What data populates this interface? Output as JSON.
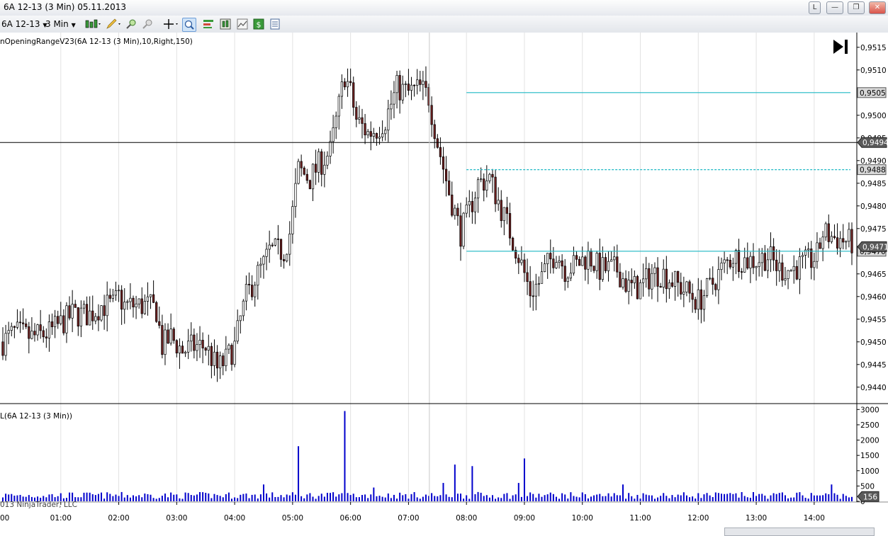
{
  "window": {
    "title": "6A 12-13 (3 Min)  05.11.2013",
    "buttons": [
      "L",
      "—",
      "❐",
      "✕"
    ]
  },
  "toolbar": {
    "instrument": "6A 12-13",
    "interval": "3 Min"
  },
  "panels": {
    "price_label": "nOpeningRangeV23(6A 12-13 (3 Min),10,Right,150)",
    "volume_label": "L(6A 12-13 (3 Min))",
    "copyright": "013 NinjaTrader, LLC",
    "left_tick": "00"
  },
  "colors": {
    "up_candle": "#ffffff",
    "down_candle": "#6e1f1f",
    "candle_outline": "#000000",
    "range_line": "#1fb8c4",
    "volume_bar": "#0000cc",
    "crosshair": "#000000"
  },
  "chart_data": [
    {
      "type": "candlestick",
      "instrument": "6A 12-13",
      "interval": "3 Min",
      "ylim": [
        0.9437,
        0.9517
      ],
      "y_ticks": [
        "0,9515",
        "0,9510",
        "0,9505",
        "0,9500",
        "0,9495",
        "0,9490",
        "0,9485",
        "0,9480",
        "0,9475",
        "0,9470",
        "0,9465",
        "0,9460",
        "0,9455",
        "0,9450",
        "0,9445",
        "0,9440"
      ],
      "x_ticks": [
        "01:00",
        "02:00",
        "03:00",
        "04:00",
        "05:00",
        "06:00",
        "07:00",
        "08:00",
        "09:00",
        "10:00",
        "11:00",
        "12:00",
        "13:00",
        "14:00"
      ],
      "x_ticks_time": [
        1,
        2,
        3,
        4,
        5,
        6,
        7,
        8,
        9,
        10,
        11,
        12,
        13,
        14
      ],
      "xlim": [
        0,
        14.65
      ],
      "price_path": [
        [
          0.0,
          0.945
        ],
        [
          0.2,
          0.9452
        ],
        [
          0.5,
          0.9451
        ],
        [
          0.8,
          0.9452
        ],
        [
          1.0,
          0.9454
        ],
        [
          1.2,
          0.9456
        ],
        [
          1.5,
          0.9456
        ],
        [
          1.7,
          0.9458
        ],
        [
          1.9,
          0.9458
        ],
        [
          2.0,
          0.946
        ],
        [
          2.1,
          0.9458
        ],
        [
          2.3,
          0.9458
        ],
        [
          2.5,
          0.9458
        ],
        [
          2.65,
          0.9457
        ],
        [
          2.75,
          0.9449
        ],
        [
          2.9,
          0.9451
        ],
        [
          3.1,
          0.9448
        ],
        [
          3.3,
          0.9449
        ],
        [
          3.5,
          0.9449
        ],
        [
          3.7,
          0.9444
        ],
        [
          3.85,
          0.9446
        ],
        [
          4.0,
          0.9449
        ],
        [
          4.1,
          0.9455
        ],
        [
          4.2,
          0.946
        ],
        [
          4.35,
          0.9464
        ],
        [
          4.5,
          0.9467
        ],
        [
          4.6,
          0.947
        ],
        [
          4.85,
          0.947
        ],
        [
          4.95,
          0.9474
        ],
        [
          5.1,
          0.9488
        ],
        [
          5.3,
          0.9486
        ],
        [
          5.45,
          0.9489
        ],
        [
          5.65,
          0.9492
        ],
        [
          5.8,
          0.9502
        ],
        [
          5.9,
          0.9509
        ],
        [
          6.0,
          0.9505
        ],
        [
          6.1,
          0.9499
        ],
        [
          6.3,
          0.9496
        ],
        [
          6.45,
          0.9497
        ],
        [
          6.6,
          0.9499
        ],
        [
          6.8,
          0.9506
        ],
        [
          7.0,
          0.9505
        ],
        [
          7.2,
          0.9506
        ],
        [
          7.35,
          0.9504
        ],
        [
          7.5,
          0.9494
        ],
        [
          7.7,
          0.9483
        ],
        [
          7.9,
          0.9474
        ],
        [
          8.05,
          0.9479
        ],
        [
          8.2,
          0.9485
        ],
        [
          8.4,
          0.9486
        ],
        [
          8.55,
          0.9481
        ],
        [
          8.7,
          0.9476
        ],
        [
          8.9,
          0.9469
        ],
        [
          9.1,
          0.9461
        ],
        [
          9.25,
          0.9463
        ],
        [
          9.4,
          0.9467
        ],
        [
          9.55,
          0.947
        ],
        [
          9.7,
          0.9466
        ],
        [
          9.9,
          0.9467
        ],
        [
          10.1,
          0.9469
        ],
        [
          10.3,
          0.9466
        ],
        [
          10.6,
          0.9466
        ],
        [
          10.8,
          0.9462
        ],
        [
          11.0,
          0.9462
        ],
        [
          11.2,
          0.9465
        ],
        [
          11.4,
          0.9465
        ],
        [
          11.6,
          0.9463
        ],
        [
          11.8,
          0.9461
        ],
        [
          12.0,
          0.9459
        ],
        [
          12.2,
          0.9462
        ],
        [
          12.4,
          0.9466
        ],
        [
          12.6,
          0.9469
        ],
        [
          12.8,
          0.9468
        ],
        [
          13.0,
          0.9468
        ],
        [
          13.2,
          0.9469
        ],
        [
          13.4,
          0.9466
        ],
        [
          13.6,
          0.9466
        ],
        [
          13.8,
          0.9467
        ],
        [
          13.95,
          0.9468
        ],
        [
          14.05,
          0.9469
        ],
        [
          14.15,
          0.9474
        ],
        [
          14.35,
          0.9473
        ],
        [
          14.6,
          0.9472
        ]
      ],
      "horizontal_lines": [
        {
          "price": 0.9505,
          "label": "0,9505",
          "from_time": 8.0,
          "style": "solid",
          "color": "#1fb8c4"
        },
        {
          "price": 0.9488,
          "label": "0,9488",
          "from_time": 8.0,
          "style": "dashed",
          "color": "#1fb8c4"
        },
        {
          "price": 0.947,
          "label": "0,9470",
          "from_time": 8.0,
          "style": "solid",
          "color": "#1fb8c4"
        }
      ],
      "price_markers": [
        {
          "price": 0.9494,
          "label": "0,9494"
        },
        {
          "price": 0.9471,
          "label": "0,9471"
        }
      ],
      "crosshair": {
        "time": 7.36,
        "price": 0.9494
      }
    },
    {
      "type": "bar",
      "series": [
        {
          "name": "L(6A 12-13 (3 Min))"
        }
      ],
      "ylim": [
        0,
        3100
      ],
      "y_ticks": [
        "3000",
        "2500",
        "2000",
        "1500",
        "1000",
        "500",
        "0"
      ],
      "current_value": "156",
      "spikes": [
        [
          5.1,
          1800
        ],
        [
          5.9,
          2950
        ],
        [
          7.8,
          1200
        ],
        [
          8.1,
          1150
        ],
        [
          9.0,
          1400
        ],
        [
          4.5,
          550
        ],
        [
          6.4,
          450
        ],
        [
          7.6,
          600
        ],
        [
          8.9,
          600
        ],
        [
          10.7,
          550
        ],
        [
          14.3,
          550
        ]
      ],
      "baseline": 160
    }
  ]
}
